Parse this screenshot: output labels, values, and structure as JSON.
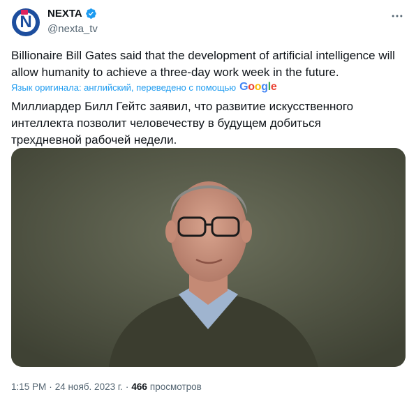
{
  "author": {
    "display_name": "NEXTA",
    "handle": "@nexta_tv",
    "avatar_letter": "N",
    "verified": true,
    "verified_color": "#1d9bf0",
    "avatar_color": "#1d4e9e"
  },
  "tweet": {
    "text": "Billionaire Bill Gates said that the development of artificial intelligence will allow humanity to achieve a three-day work week in the future.",
    "translation_note": "Язык оригинала: английский, переведено с помощью",
    "translation_provider": "Google",
    "translated_text": "Миллиардер Билл Гейтс заявил, что развитие искусственного интеллекта позволит человечеству в будущем добиться трехдневной рабочей недели."
  },
  "meta": {
    "time": "1:15 PM",
    "date": "24 нояб. 2023 г.",
    "views_count": "466",
    "views_label": "просмотров"
  },
  "colors": {
    "text": "#0f1419",
    "secondary": "#536471",
    "link": "#1d9bf0"
  },
  "icons": {
    "more": "more-horizontal-icon",
    "verified": "verified-badge-icon"
  }
}
